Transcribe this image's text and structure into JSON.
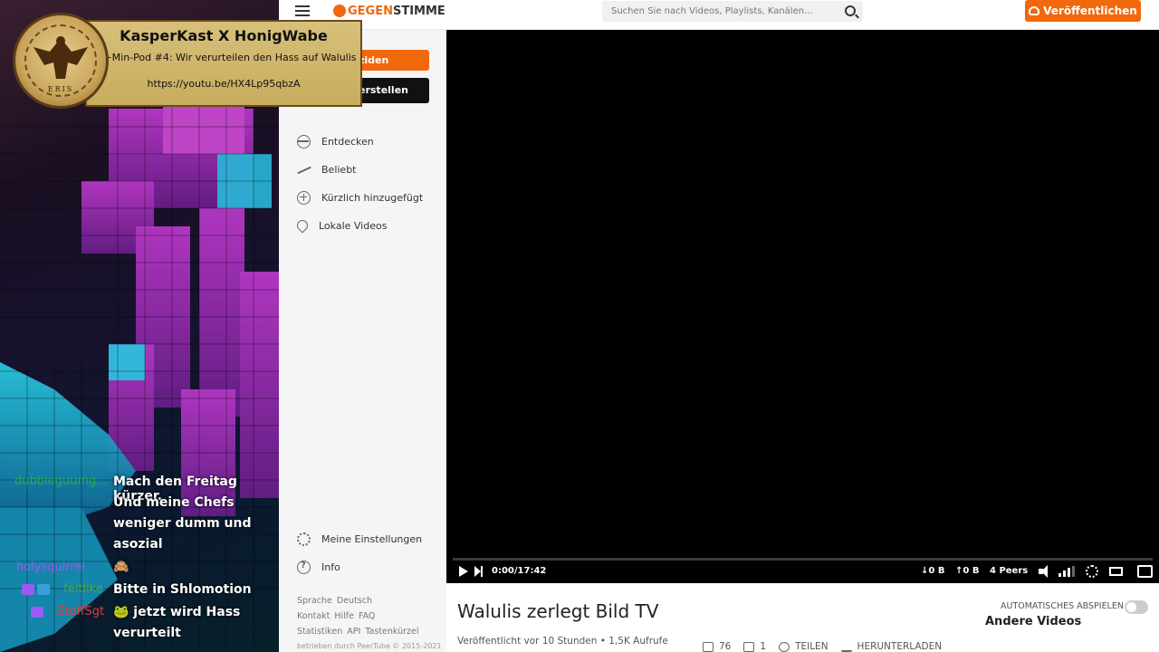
{
  "overlay": {
    "title": "KasperKast X HonigWabe",
    "subtitle": "20+Min-Pod #4: Wir verurteilen den Hass auf Walulis",
    "link": "https://youtu.be/HX4Lp95qbzA",
    "logo_text": "ERIS"
  },
  "chat": [
    {
      "user": "dubbleguumg...",
      "user_color": "#2db34a",
      "lines": [
        "Mach den Freitag kürzer.",
        "Und meine Chefs",
        "weniger dumm und",
        "asozial"
      ]
    },
    {
      "user": "holysquirrel",
      "user_color": "#9b59f5",
      "lines": [
        "🙈"
      ]
    },
    {
      "user": "feitlike",
      "user_color": "#4aa34a",
      "lines": [
        "Bitte in Shlomotion"
      ]
    },
    {
      "user": "SteffSgt",
      "user_color": "#e23b3b",
      "lines": [
        "🐸 jetzt wird Hass",
        "verurteilt"
      ]
    }
  ],
  "topbar": {
    "logo_gegen": "GEGEN",
    "logo_stimme": "STIMME",
    "search_placeholder": "Suchen Sie nach Videos, Playlists, Kanälen...",
    "publish_label": "Veröffentlichen",
    "accent": "#f1680d"
  },
  "sidebar": {
    "login_label": "ziden",
    "create_label": "erstellen",
    "nav": [
      {
        "label": "Entdecken",
        "icon": "globe-icon"
      },
      {
        "label": "Beliebt",
        "icon": "trending-icon"
      },
      {
        "label": "Kürzlich hinzugefügt",
        "icon": "plus-circle-icon"
      },
      {
        "label": "Lokale Videos",
        "icon": "location-icon"
      }
    ],
    "bottom": [
      {
        "label": "Meine Einstellungen",
        "icon": "gear-icon"
      },
      {
        "label": "Info",
        "icon": "info-icon"
      }
    ],
    "footer_row1": [
      "Sprache",
      "Deutsch"
    ],
    "footer_row2": [
      "Kontakt",
      "Hilfe",
      "FAQ"
    ],
    "footer_row3": [
      "Statistiken",
      "API",
      "Tastenkürzel"
    ],
    "powered": "betrieben durch PeerTube © 2015-2021"
  },
  "player": {
    "time": "0:00/17:42",
    "download": "↓0 B",
    "upload": "↑0 B",
    "peers": "4 Peers",
    "progress": 0
  },
  "video": {
    "title": "Walulis zerlegt Bild TV",
    "meta": "Veröffentlicht vor 10 Stunden • 1,5K Aufrufe",
    "likes": "76",
    "dislikes": "1",
    "share": "TEILEN",
    "download": "HERUNTERLADEN",
    "autoplay": "AUTOMATISCHES ABSPIELEN",
    "other_videos": "Andere Videos"
  }
}
